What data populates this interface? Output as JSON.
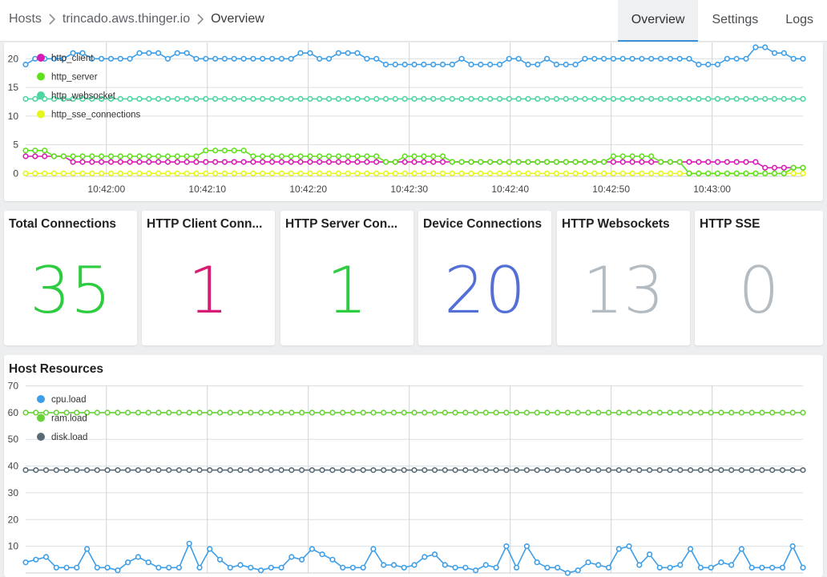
{
  "breadcrumb": {
    "hosts": "Hosts",
    "host": "trincado.aws.thinger.io",
    "current": "Overview"
  },
  "tabs": [
    {
      "label": "Overview",
      "active": true
    },
    {
      "label": "Settings",
      "active": false
    },
    {
      "label": "Logs",
      "active": false
    }
  ],
  "cards": [
    {
      "title": "Total Connections",
      "value": "35",
      "color": "#2ecc40"
    },
    {
      "title": "HTTP Client Conn...",
      "value": "1",
      "color": "#d81b73"
    },
    {
      "title": "HTTP Server Con...",
      "value": "1",
      "color": "#2ecc40"
    },
    {
      "title": "Device Connections",
      "value": "20",
      "color": "#5470d6"
    },
    {
      "title": "HTTP Websockets",
      "value": "13",
      "color": "#b4bcc2"
    },
    {
      "title": "HTTP SSE",
      "value": "0",
      "color": "#b4bcc2"
    }
  ],
  "chart_data": [
    {
      "type": "line",
      "title": "",
      "xlabel": "",
      "ylabel": "",
      "ylim": [
        -0.5,
        22
      ],
      "yticks": [
        0,
        5,
        10,
        15,
        20
      ],
      "xticks": [
        "10:42:00",
        "10:42:10",
        "10:42:20",
        "10:42:30",
        "10:42:40",
        "10:42:50",
        "10:43:00"
      ],
      "x_start": "10:41:52",
      "x_end": "10:43:09",
      "grid": true,
      "legend_position": "top-left",
      "series": [
        {
          "name": "",
          "color": "#3d9ee8",
          "values": [
            19,
            20,
            20,
            20,
            20,
            21,
            21,
            20,
            20,
            20,
            20,
            20,
            21,
            21,
            21,
            20,
            21,
            21,
            20,
            20,
            20,
            20,
            20,
            20,
            20,
            20,
            20,
            20,
            20,
            21,
            21,
            20,
            20,
            21,
            21,
            21,
            20,
            20,
            19,
            19,
            19,
            19,
            19,
            19,
            19,
            19,
            20,
            19,
            19,
            19,
            19,
            20,
            20,
            19,
            19,
            20,
            19,
            19,
            19,
            20,
            20,
            20,
            20,
            20,
            20,
            20,
            20,
            20,
            20,
            20,
            20,
            19,
            19,
            19,
            20,
            20,
            20,
            22,
            22,
            21,
            21,
            20,
            20
          ]
        },
        {
          "name": "http_client",
          "color": "#d81bb4",
          "values": [
            3,
            3,
            3,
            3,
            3,
            2,
            2,
            2,
            2,
            2,
            2,
            2,
            2,
            2,
            2,
            2,
            2,
            2,
            2,
            2,
            2,
            2,
            2,
            2,
            2,
            2,
            2,
            2,
            2,
            2,
            2,
            2,
            2,
            2,
            2,
            2,
            2,
            2,
            2,
            2,
            2,
            2,
            2,
            2,
            2,
            2,
            2,
            2,
            2,
            2,
            2,
            2,
            2,
            2,
            2,
            2,
            2,
            2,
            2,
            2,
            2,
            2,
            2,
            2,
            2,
            2,
            2,
            2,
            2,
            2,
            2,
            2,
            2,
            2,
            2,
            2,
            2,
            2,
            1,
            1,
            1,
            1,
            1
          ]
        },
        {
          "name": "http_server",
          "color": "#5ee01a",
          "values": [
            4,
            4,
            4,
            3,
            3,
            3,
            3,
            3,
            3,
            3,
            3,
            3,
            3,
            3,
            3,
            3,
            3,
            3,
            3,
            4,
            4,
            4,
            4,
            4,
            3,
            3,
            3,
            3,
            3,
            3,
            3,
            3,
            3,
            3,
            3,
            3,
            3,
            3,
            2,
            2,
            3,
            3,
            3,
            3,
            3,
            2,
            2,
            2,
            2,
            2,
            2,
            2,
            2,
            2,
            2,
            2,
            2,
            2,
            2,
            2,
            2,
            2,
            3,
            3,
            3,
            3,
            3,
            2,
            2,
            2,
            0,
            0,
            0,
            0,
            0,
            0,
            0,
            0,
            0,
            0,
            0,
            1,
            1
          ]
        },
        {
          "name": "http_websocket",
          "color": "#4fd6a0",
          "values": [
            13,
            13,
            13,
            13,
            13,
            13,
            13,
            13,
            13,
            13,
            13,
            13,
            13,
            13,
            13,
            13,
            13,
            13,
            13,
            13,
            13,
            13,
            13,
            13,
            13,
            13,
            13,
            13,
            13,
            13,
            13,
            13,
            13,
            13,
            13,
            13,
            13,
            13,
            13,
            13,
            13,
            13,
            13,
            13,
            13,
            13,
            13,
            13,
            13,
            13,
            13,
            13,
            13,
            13,
            13,
            13,
            13,
            13,
            13,
            13,
            13,
            13,
            13,
            13,
            13,
            13,
            13,
            13,
            13,
            13,
            13,
            13,
            13,
            13,
            13,
            13,
            13,
            13,
            13,
            13,
            13,
            13,
            13
          ]
        },
        {
          "name": "http_sse_connections",
          "color": "#e6f51a",
          "values": [
            0,
            0,
            0,
            0,
            0,
            0,
            0,
            0,
            0,
            0,
            0,
            0,
            0,
            0,
            0,
            0,
            0,
            0,
            0,
            0,
            0,
            0,
            0,
            0,
            0,
            0,
            0,
            0,
            0,
            0,
            0,
            0,
            0,
            0,
            0,
            0,
            0,
            0,
            0,
            0,
            0,
            0,
            0,
            0,
            0,
            0,
            0,
            0,
            0,
            0,
            0,
            0,
            0,
            0,
            0,
            0,
            0,
            0,
            0,
            0,
            0,
            0,
            0,
            0,
            0,
            0,
            0,
            0,
            0,
            0,
            0,
            0,
            0,
            0,
            0,
            0,
            0,
            0,
            0,
            0,
            0,
            0,
            0
          ]
        }
      ]
    },
    {
      "type": "line",
      "title": "Host Resources",
      "xlabel": "",
      "ylabel": "",
      "ylim": [
        0,
        70
      ],
      "yticks": [
        10,
        20,
        30,
        40,
        50,
        60,
        70
      ],
      "x_start": "10:41:52",
      "x_end": "10:43:09",
      "grid": true,
      "legend_position": "top-left",
      "series": [
        {
          "name": "cpu.load",
          "color": "#3d9ee8",
          "values": [
            4,
            5,
            6,
            2,
            2,
            2,
            9,
            2,
            2,
            1,
            4,
            6,
            4,
            2,
            2,
            2,
            11,
            2,
            9,
            5,
            2,
            3,
            2,
            1,
            2,
            2,
            6,
            5,
            9,
            7,
            5,
            2,
            2,
            2,
            9,
            3,
            3,
            2,
            3,
            6,
            7,
            3,
            2,
            2,
            1,
            3,
            2,
            10,
            2,
            10,
            4,
            2,
            2,
            0,
            1,
            4,
            3,
            2,
            9,
            10,
            3,
            7,
            2,
            2,
            3,
            9,
            2,
            2,
            4,
            3,
            9,
            2,
            2,
            2,
            2,
            10,
            2
          ]
        },
        {
          "name": "ram.load",
          "color": "#6ad23a",
          "values": [
            60,
            60,
            60,
            60,
            60,
            60,
            60,
            60,
            60,
            60,
            60,
            60,
            60,
            60,
            60,
            60,
            60,
            60,
            60,
            60,
            60,
            60,
            60,
            60,
            60,
            60,
            60,
            60,
            60,
            60,
            60,
            60,
            60,
            60,
            60,
            60,
            60,
            60,
            60,
            60,
            60,
            60,
            60,
            60,
            60,
            60,
            60,
            60,
            60,
            60,
            60,
            60,
            60,
            60,
            60,
            60,
            60,
            60,
            60,
            60,
            60,
            60,
            60,
            60,
            60,
            60,
            60,
            60,
            60,
            60,
            60,
            60,
            60,
            60,
            60,
            60,
            60
          ]
        },
        {
          "name": "disk.load",
          "color": "#596b77",
          "values": [
            38.5,
            38.5,
            38.5,
            38.5,
            38.5,
            38.5,
            38.5,
            38.5,
            38.5,
            38.5,
            38.5,
            38.5,
            38.5,
            38.5,
            38.5,
            38.5,
            38.5,
            38.5,
            38.5,
            38.5,
            38.5,
            38.5,
            38.5,
            38.5,
            38.5,
            38.5,
            38.5,
            38.5,
            38.5,
            38.5,
            38.5,
            38.5,
            38.5,
            38.5,
            38.5,
            38.5,
            38.5,
            38.5,
            38.5,
            38.5,
            38.5,
            38.5,
            38.5,
            38.5,
            38.5,
            38.5,
            38.5,
            38.5,
            38.5,
            38.5,
            38.5,
            38.5,
            38.5,
            38.5,
            38.5,
            38.5,
            38.5,
            38.5,
            38.5,
            38.5,
            38.5,
            38.5,
            38.5,
            38.5,
            38.5,
            38.5,
            38.5,
            38.5,
            38.5,
            38.5,
            38.5,
            38.5,
            38.5,
            38.5,
            38.5,
            38.5,
            38.5
          ]
        }
      ]
    }
  ]
}
